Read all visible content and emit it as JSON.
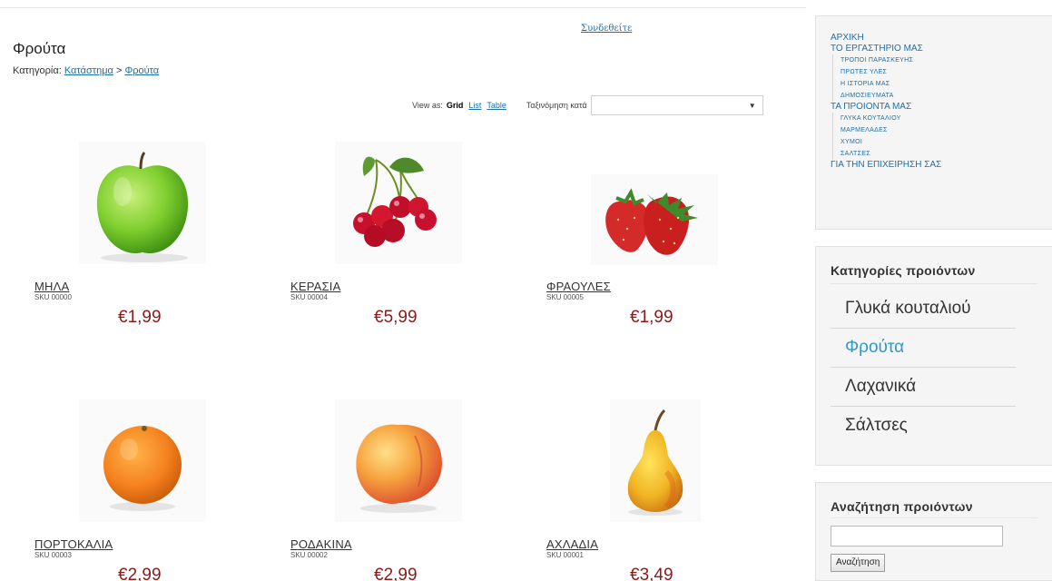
{
  "header": {
    "login_link": "Συνδεθείτε"
  },
  "page": {
    "title": "Φρούτα",
    "breadcrumb_prefix": "Κατηγορία:",
    "breadcrumb_store": "Κατάστημα",
    "breadcrumb_sep": ">",
    "breadcrumb_current": "Φρούτα"
  },
  "toolbar": {
    "view_as_label": "View as:",
    "view_grid": "Grid",
    "view_list": "List",
    "view_table": "Table",
    "sort_label": "Ταξινόμηση κατά",
    "sort_value": ""
  },
  "products": [
    {
      "name": "ΜΗΛΑ",
      "sku": "SKU 00000",
      "price": "€1,99",
      "icon": "apple-image"
    },
    {
      "name": "ΚΕΡΑΣΙΑ",
      "sku": "SKU 00004",
      "price": "€5,99",
      "icon": "cherries-image"
    },
    {
      "name": "ΦΡΑΟΥΛΕΣ",
      "sku": "SKU 00005",
      "price": "€1,99",
      "icon": "strawberries-image"
    },
    {
      "name": "ΠΟΡΤΟΚΑΛΙΑ",
      "sku": "SKU 00003",
      "price": "€2,99",
      "icon": "orange-image"
    },
    {
      "name": "ΡΟΔΑΚΙΝΑ",
      "sku": "SKU 00002",
      "price": "€2,99",
      "icon": "peach-image"
    },
    {
      "name": "ΑΧΛΑΔΙΑ",
      "sku": "SKU 00001",
      "price": "€3,49",
      "icon": "pear-image"
    }
  ],
  "sidebar": {
    "nav": {
      "home": "ΑΡΧΙΚΗ",
      "workshop": "ΤΟ ΕΡΓΑΣΤΗΡΙΟ ΜΑΣ",
      "workshop_sub": [
        "ΤΡΟΠΟΙ ΠΑΡΑΣΚΕΥΗΣ",
        "ΠΡΩΤΕΣ ΥΛΕΣ",
        "Η ΙΣΤΟΡΙΑ ΜΑΣ",
        "ΔΗΜΟΣΙΕΥΜΑΤΑ"
      ],
      "products": "ΤΑ ΠΡΟΙΟΝΤΑ ΜΑΣ",
      "products_sub": [
        "ΓΛΥΚΑ ΚΟΥΤΑΛΙΟΥ",
        "ΜΑΡΜΕΛΑΔΕΣ",
        "ΧΥΜΟΙ",
        "ΣΑΛΤΣΕΣ"
      ],
      "business": "ΓΙΑ ΤΗΝ ΕΠΙΧΕΙΡΗΣΗ ΣΑΣ"
    },
    "categories": {
      "title": "Κατηγορίες προιόντων",
      "items": [
        "Γλυκά κουταλιού",
        "Φρούτα",
        "Λαχανικά",
        "Σάλτσες"
      ],
      "active_color": "#2b9bc4"
    },
    "search": {
      "title": "Αναζήτηση προιόντων",
      "input_value": "",
      "button_label": "Αναζήτηση"
    }
  },
  "colors": {
    "price": "#8b1a1a",
    "link": "#1e6fa8",
    "sidebar_bg": "#f5f5f5"
  }
}
